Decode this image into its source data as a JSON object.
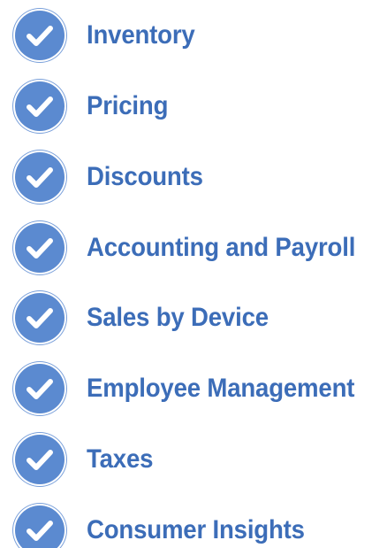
{
  "features": {
    "items": [
      {
        "label": "Inventory",
        "icon": "check-circle-icon"
      },
      {
        "label": "Pricing",
        "icon": "check-circle-icon"
      },
      {
        "label": "Discounts",
        "icon": "check-circle-icon"
      },
      {
        "label": "Accounting and Payroll",
        "icon": "check-circle-icon"
      },
      {
        "label": "Sales by Device",
        "icon": "check-circle-icon"
      },
      {
        "label": "Employee Management",
        "icon": "check-circle-icon"
      },
      {
        "label": "Taxes",
        "icon": "check-circle-icon"
      },
      {
        "label": "Consumer Insights",
        "icon": "check-circle-icon"
      }
    ]
  },
  "colors": {
    "accent": "#3c6db8",
    "icon_fill": "#5b8ad0",
    "check_mark": "#ffffff"
  }
}
